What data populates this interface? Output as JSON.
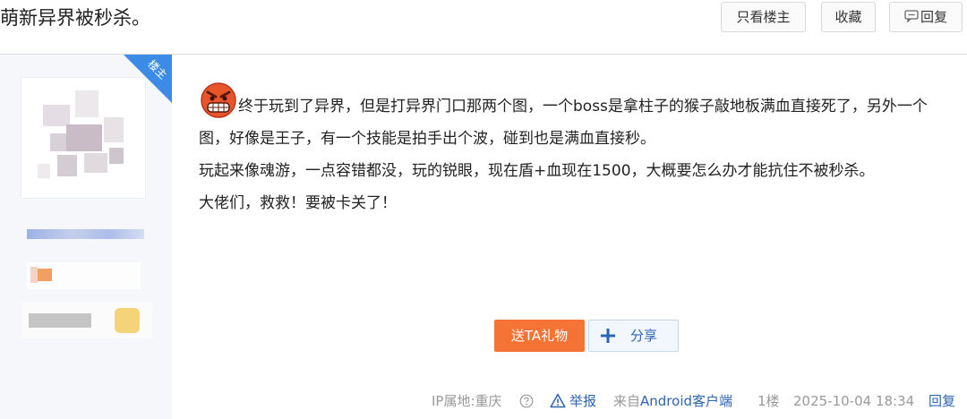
{
  "header": {
    "title": "萌新异界被秒杀。",
    "only_op_label": "只看楼主",
    "favorite_label": "收藏",
    "reply_label": "回复"
  },
  "author": {
    "op_tag": "楼主"
  },
  "post": {
    "lines": [
      "终于玩到了异界，但是打异界门口那两个图，一个boss是拿柱子的猴子敲地板满血直接死了，另外一个图，好像是王子，有一个技能是拍手出个波，碰到也是满血直接秒。",
      "玩起来像魂游，一点容错都没，玩的锐眼，现在盾+血现在1500，大概要怎么办才能抗住不被秒杀。",
      "大佬们，救救！要被卡关了！"
    ],
    "gift_label": "送TA礼物",
    "share_label": "分享"
  },
  "footer": {
    "ip_location": "IP属地:重庆",
    "report_label": "举报",
    "from_prefix": "来自",
    "client": "Android客户端",
    "floor": "1楼",
    "timestamp": "2025-10-04 18:34",
    "reply_label": "回复"
  },
  "icons": {
    "op_corner": "corner-ribbon",
    "emoji": "angry-face-icon",
    "reply": "comment-icon",
    "share": "plus-icon",
    "help": "question-circle-icon",
    "report": "warning-triangle-icon"
  },
  "colors": {
    "accent_blue": "#2d64b3",
    "gift_orange": "#f57435",
    "corner_blue": "#3c8ce7"
  }
}
